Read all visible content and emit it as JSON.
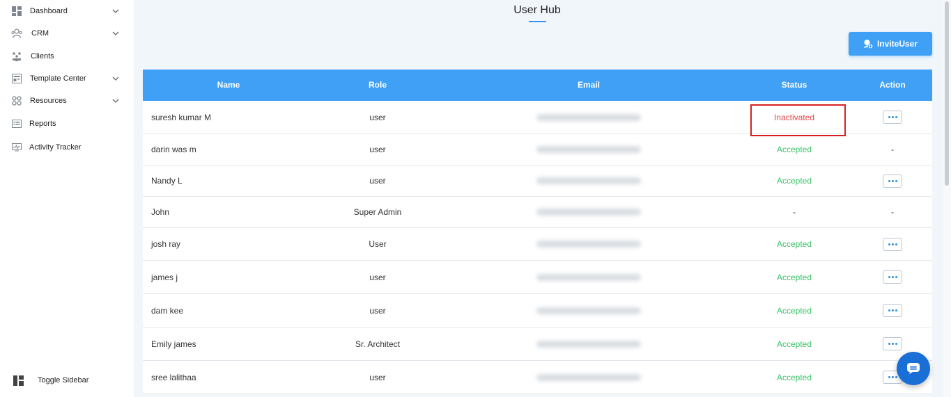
{
  "sidebar": {
    "items": [
      {
        "label": "Dashboard",
        "icon": "dashboard-icon",
        "expandable": true
      },
      {
        "label": "CRM",
        "icon": "crm-icon",
        "expandable": true
      },
      {
        "label": "Clients",
        "icon": "clients-icon",
        "expandable": false
      },
      {
        "label": "Template Center",
        "icon": "template-icon",
        "expandable": true
      },
      {
        "label": "Resources",
        "icon": "resources-icon",
        "expandable": true
      },
      {
        "label": "Reports",
        "icon": "reports-icon",
        "expandable": false
      },
      {
        "label": "Activity Tracker",
        "icon": "activity-icon",
        "expandable": false
      }
    ],
    "toggle_label": "Toggle Sidebar"
  },
  "page": {
    "title": "User Hub",
    "invite_label": "InviteUser"
  },
  "table": {
    "headers": {
      "name": "Name",
      "role": "Role",
      "email": "Email",
      "status": "Status",
      "action": "Action"
    },
    "rows": [
      {
        "name": "suresh kumar M",
        "role": "user",
        "status": "Inactivated",
        "status_type": "inactivated",
        "action": "menu"
      },
      {
        "name": "darin was m",
        "role": "user",
        "status": "Accepted",
        "status_type": "accepted",
        "action": "-"
      },
      {
        "name": "Nandy L",
        "role": "user",
        "status": "Accepted",
        "status_type": "accepted",
        "action": "menu"
      },
      {
        "name": "John",
        "role": "Super Admin",
        "status": "-",
        "status_type": "dash",
        "action": "-"
      },
      {
        "name": "josh ray",
        "role": "User",
        "status": "Accepted",
        "status_type": "accepted",
        "action": "menu"
      },
      {
        "name": "james  j",
        "role": "user",
        "status": "Accepted",
        "status_type": "accepted",
        "action": "menu"
      },
      {
        "name": "dam kee",
        "role": "user",
        "status": "Accepted",
        "status_type": "accepted",
        "action": "menu"
      },
      {
        "name": "Emily james",
        "role": "Sr. Architect",
        "status": "Accepted",
        "status_type": "accepted",
        "action": "menu"
      },
      {
        "name": "sree lalithaa",
        "role": "user",
        "status": "Accepted",
        "status_type": "accepted",
        "action": "menu"
      }
    ]
  },
  "colors": {
    "accent": "#3fa0f5",
    "accepted": "#3cc36b",
    "inactivated": "#e54848",
    "highlight": "#d62020"
  }
}
